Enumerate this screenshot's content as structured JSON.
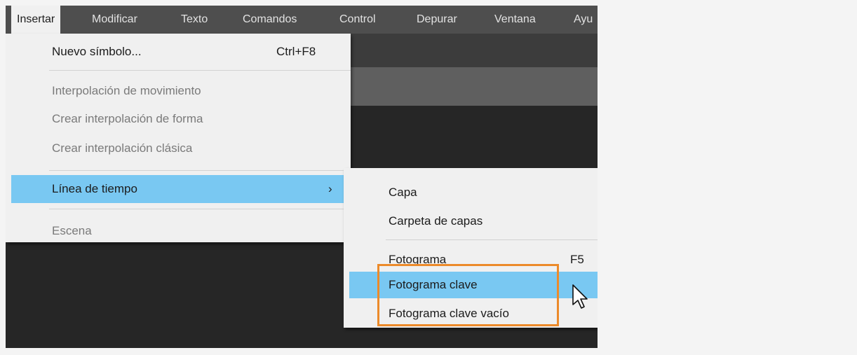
{
  "menubar": {
    "items": [
      {
        "label": "Insertar",
        "active": true
      },
      {
        "label": "Modificar"
      },
      {
        "label": "Texto"
      },
      {
        "label": "Comandos"
      },
      {
        "label": "Control"
      },
      {
        "label": "Depurar"
      },
      {
        "label": "Ventana"
      },
      {
        "label": "Ayu"
      }
    ]
  },
  "insert_menu": {
    "new_symbol": {
      "label": "Nuevo símbolo...",
      "shortcut": "Ctrl+F8"
    },
    "motion_tween": {
      "label": "Interpolación de movimiento",
      "enabled": false
    },
    "shape_tween": {
      "label": "Crear interpolación de forma",
      "enabled": false
    },
    "classic_tween": {
      "label": "Crear interpolación clásica",
      "enabled": false
    },
    "timeline": {
      "label": "Línea de tiempo",
      "arrow": "›",
      "highlighted": true
    },
    "scene": {
      "label": "Escena",
      "enabled": false
    }
  },
  "timeline_submenu": {
    "layer": {
      "label": "Capa"
    },
    "layer_folder": {
      "label": "Carpeta de capas"
    },
    "frame": {
      "label": "Fotograma",
      "shortcut": "F5"
    },
    "keyframe": {
      "label": "Fotograma clave",
      "highlighted": true
    },
    "blank_keyframe": {
      "label": "Fotograma clave vacío"
    }
  },
  "colors": {
    "highlight": "#79c8f2",
    "annotation_box": "#ec8a2a",
    "menu_bg": "#f0f0f0",
    "menubar_bg": "#4e4e4e"
  },
  "icons": {
    "cursor": "mouse-pointer-icon",
    "submenu_arrow": "chevron-right-icon"
  }
}
